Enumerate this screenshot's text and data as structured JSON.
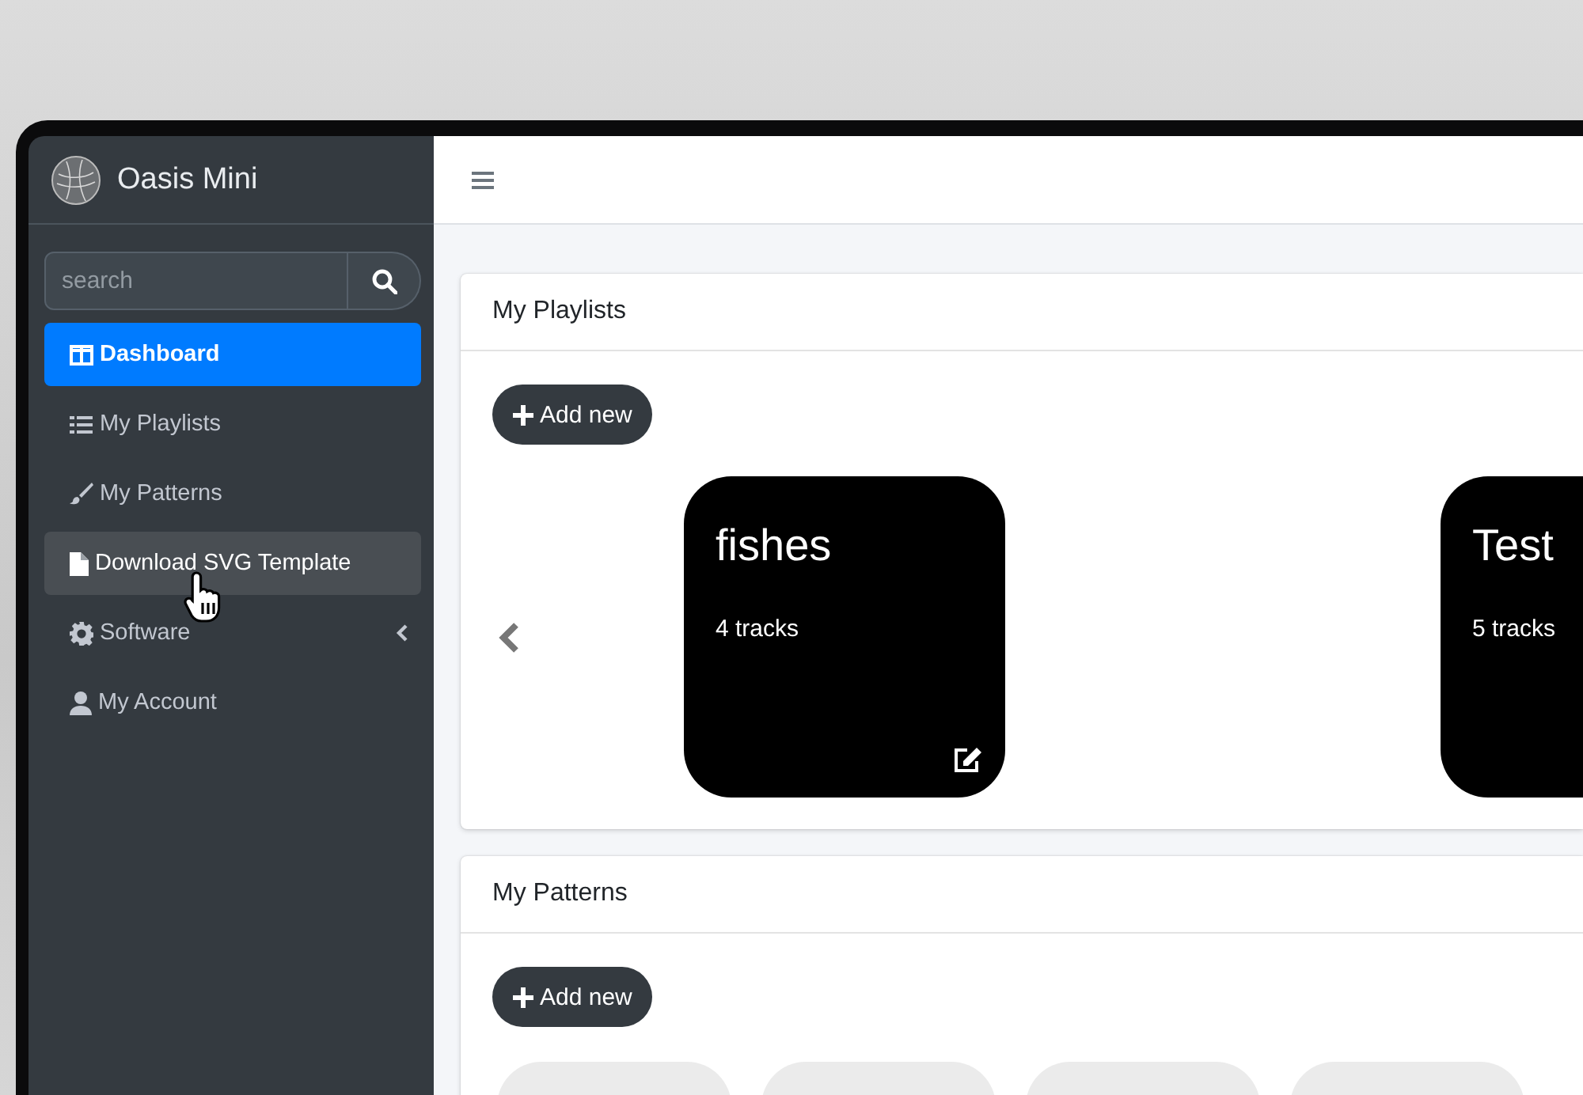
{
  "brand": {
    "name": "Oasis Mini"
  },
  "search": {
    "placeholder": "search"
  },
  "nav": [
    {
      "label": "Dashboard",
      "selected": true,
      "hovered": false,
      "expandable": false
    },
    {
      "label": "My Playlists",
      "selected": false,
      "hovered": false,
      "expandable": false
    },
    {
      "label": "My Patterns",
      "selected": false,
      "hovered": false,
      "expandable": false
    },
    {
      "label": "Download SVG Template",
      "selected": false,
      "hovered": true,
      "expandable": false
    },
    {
      "label": "Software",
      "selected": false,
      "hovered": false,
      "expandable": true
    },
    {
      "label": "My Account",
      "selected": false,
      "hovered": false,
      "expandable": false
    }
  ],
  "playlists": {
    "title": "My Playlists",
    "add_button": "Add new",
    "items": [
      {
        "name": "fishes",
        "count": "4 tracks"
      },
      {
        "name": "Test",
        "count": "5 tracks"
      }
    ]
  },
  "patterns": {
    "title": "My Patterns",
    "add_button": "Add new",
    "items": [
      {
        "kind": "loading"
      },
      {
        "kind": "loading"
      },
      {
        "kind": "loading"
      },
      {
        "kind": "loading"
      }
    ]
  }
}
